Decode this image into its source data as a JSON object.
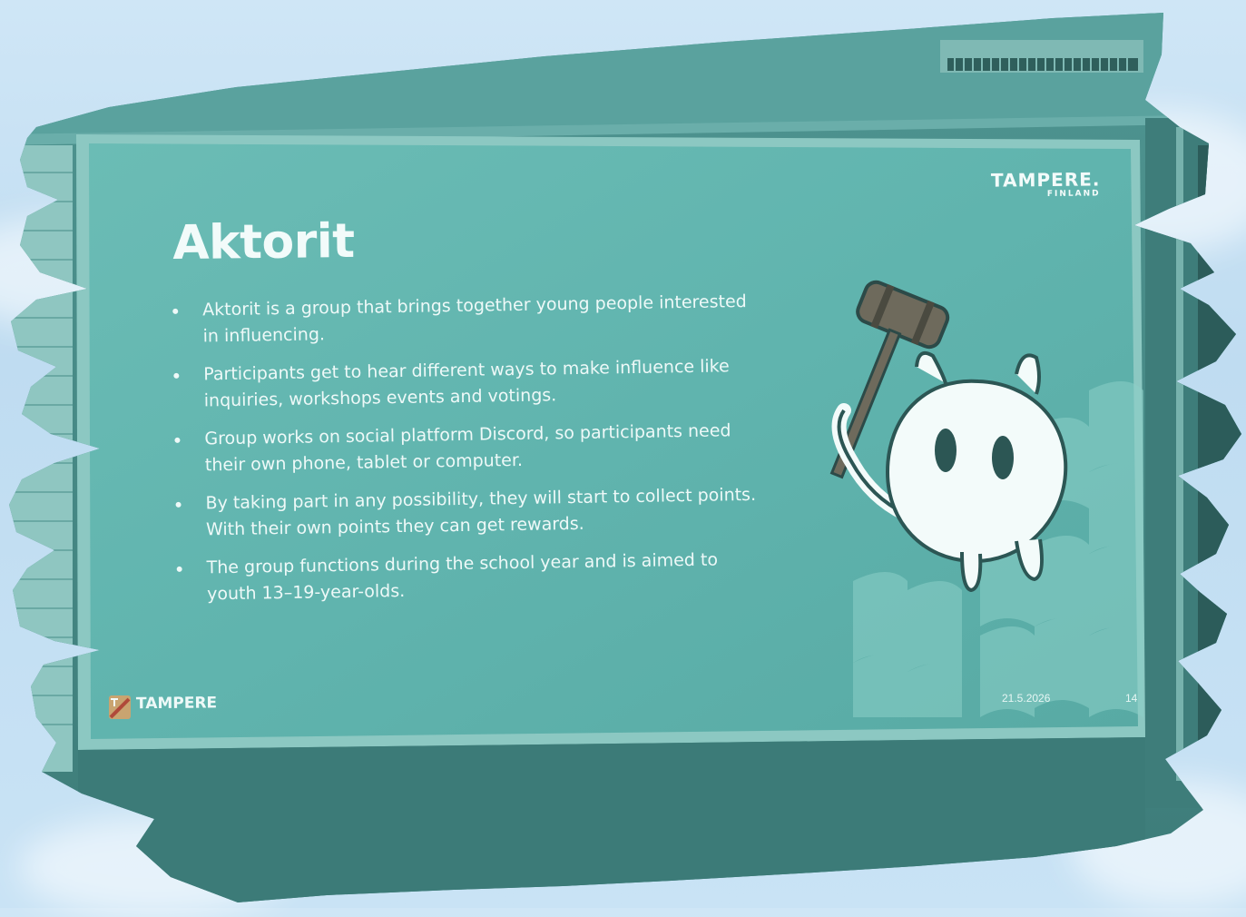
{
  "slide": {
    "title": "Aktorit",
    "bullets": [
      {
        "text": "Aktorit is a group that brings together young people interested in influencing."
      },
      {
        "text": "Participants get to hear different ways to make influence like inquiries, workshops events and votings."
      },
      {
        "text": "Group works on social platform Discord, so participants need their own phone, tablet or computer."
      },
      {
        "text": "By taking part in any possibility, they will start to collect points. With their own points they can get rewards."
      },
      {
        "text": "The group functions during the school year and is aimed to youth 13–19-year-olds."
      }
    ],
    "date": "21.5.2026",
    "page_number": "14"
  },
  "branding": {
    "top_main": "TAMPERE.",
    "top_sub": "FINLAND",
    "footer_name": "TAMPERE"
  },
  "illustration": {
    "subject": "white cat mascot holding gavel",
    "icons": [
      "gavel-icon",
      "cat-mascot"
    ]
  },
  "colors": {
    "slide_teal": "#5fb3ad",
    "frame_dark": "#3f7f7c",
    "text_light": "#eef9f8",
    "sky": "#c6e1f4"
  }
}
